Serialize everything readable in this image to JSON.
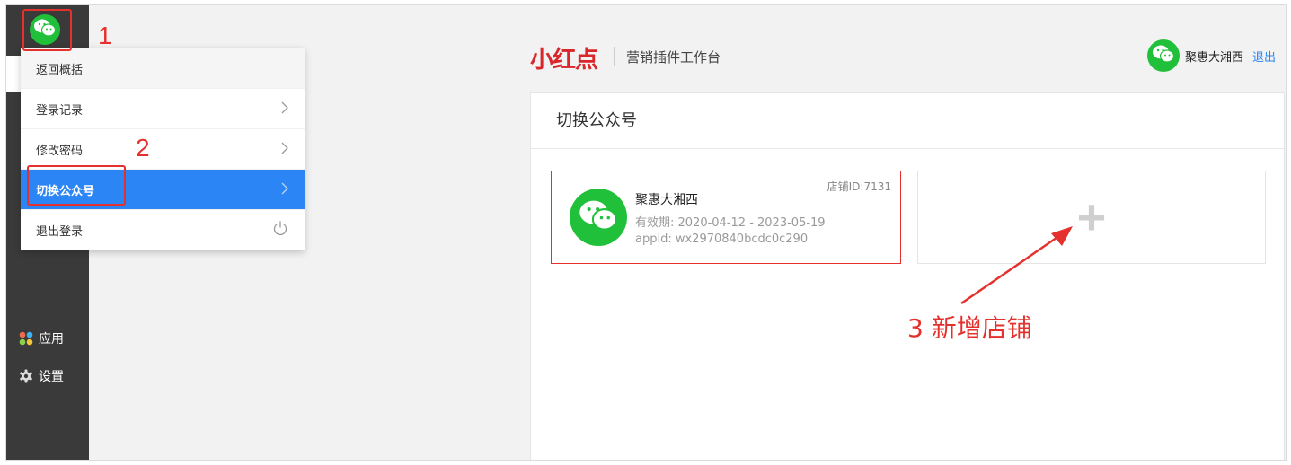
{
  "sidebar": {
    "nav": [
      {
        "label": "应用",
        "icon": "apps-icon"
      },
      {
        "label": "设置",
        "icon": "gear-icon"
      }
    ]
  },
  "menu": {
    "items": [
      {
        "label": "返回概括"
      },
      {
        "label": "登录记录"
      },
      {
        "label": "修改密码"
      },
      {
        "label": "切换公众号"
      },
      {
        "label": "退出登录"
      }
    ]
  },
  "header": {
    "logo_text": "小红点",
    "subtitle": "营销插件工作台",
    "user_name": "聚惠大湘西",
    "logout": "退出"
  },
  "panel": {
    "title": "切换公众号",
    "account": {
      "store_id": "店铺ID:7131",
      "name": "聚惠大湘西",
      "validity": "有效期: 2020-04-12 - 2023-05-19",
      "appid": "appid: wx2970840bcdc0c290"
    },
    "add_symbol": "+"
  },
  "annotations": {
    "step1": "1",
    "step2": "2",
    "step3": "3 新增店铺"
  },
  "colors": {
    "accent_blue": "#2b85f5",
    "annotation_red": "#e5312d",
    "wechat_green": "#21c03a",
    "brand_red": "#d8262a"
  }
}
